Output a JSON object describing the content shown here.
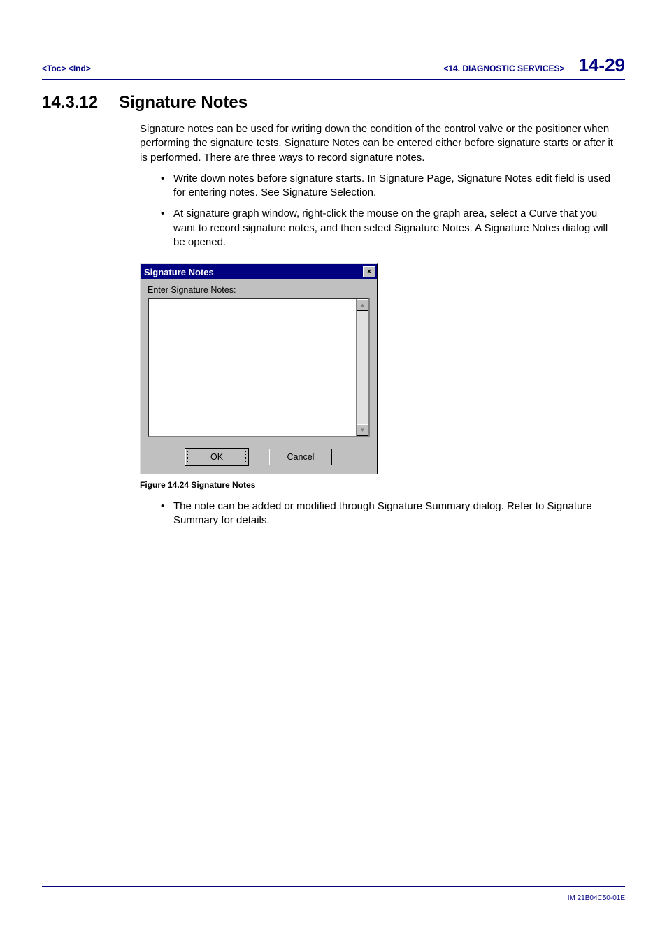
{
  "header": {
    "toc_link": "<Toc>",
    "ind_link": "<Ind>",
    "section_label": "<14.  DIAGNOSTIC SERVICES>",
    "page_number": "14-29"
  },
  "section": {
    "number": "14.3.12",
    "title": "Signature Notes"
  },
  "paragraphs": {
    "intro": "Signature notes can be used for writing down the condition of the control valve or the positioner when performing the signature tests.  Signature Notes can be entered either before signature starts or after it is performed. There are three ways to record signature notes.",
    "bullet1": "Write down notes before signature starts. In  Signature Page, Signature Notes edit field is used for entering  notes. See Signature Selection.",
    "bullet2": "At signature graph window, right-click the mouse on the graph area, select  a Curve that you want to record signature notes, and then select Signature Notes.  A Signature Notes dialog will be opened.",
    "bullet3": "The note can be added or modified through Signature Summary dialog. Refer to Signature Summary for details."
  },
  "dialog": {
    "title": "Signature Notes",
    "close_glyph": "×",
    "label": "Enter Signature Notes:",
    "scroll_up_glyph": "▲",
    "scroll_down_glyph": "▼",
    "ok_label": "OK",
    "cancel_label": "Cancel"
  },
  "figure_caption": "Figure 14.24  Signature Notes",
  "footer": {
    "doc_id": "IM 21B04C50-01E"
  }
}
